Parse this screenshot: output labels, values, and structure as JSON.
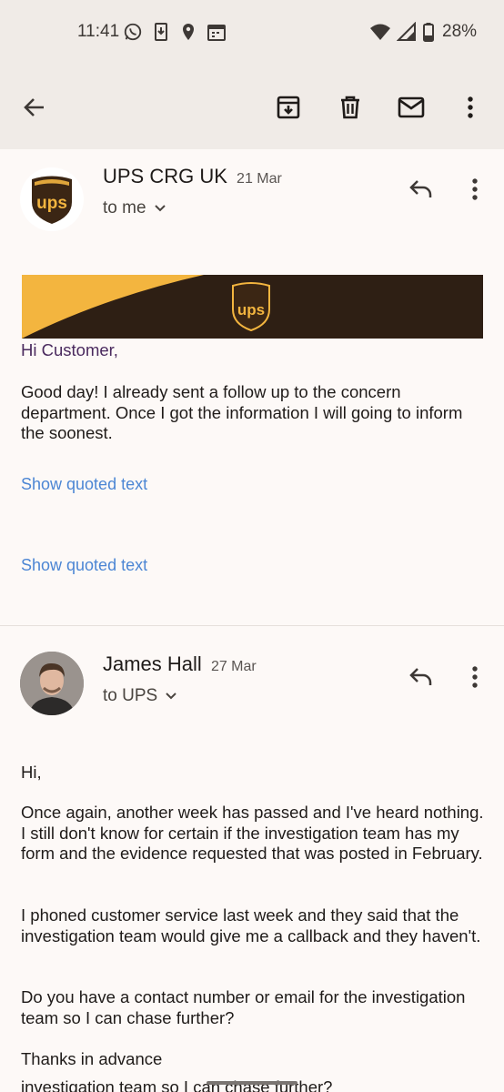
{
  "status": {
    "time": "11:41",
    "battery": "28%"
  },
  "toolbar": {
    "back": "back",
    "archive": "archive",
    "delete": "delete",
    "mark_unread": "mark unread",
    "more": "more"
  },
  "messages": [
    {
      "sender": "UPS CRG UK",
      "date": "21 Mar",
      "recipient": "to me",
      "greeting": "Hi Customer,",
      "body": "Good day! I already sent a follow up to the concern department. Once I got the information I will going to inform the soonest.",
      "quoted_1": "Show quoted text",
      "quoted_2": "Show quoted text",
      "logo_text": "ups"
    },
    {
      "sender": "James Hall",
      "date": "27 Mar",
      "recipient": "to UPS",
      "paragraphs": [
        "Hi,",
        "Once again, another week has passed and I've heard nothing. I still don't know for certain if the investigation team has my form and the evidence requested that was posted in February.",
        "I phoned customer service last week and they said that the investigation team would give me a callback and they haven't.",
        "Do you have a contact number or email for the investigation team so I can chase further?",
        "Thanks in advance"
      ],
      "peek": "investigation team so I can chase further?"
    }
  ],
  "icons": [
    "whatsapp-icon",
    "download-icon",
    "location-icon",
    "calendar-icon",
    "wifi-icon",
    "signal-icon",
    "battery-icon",
    "back-arrow-icon",
    "archive-icon",
    "trash-icon",
    "mail-icon",
    "more-vert-icon",
    "reply-icon",
    "chevron-down-icon"
  ],
  "colors": {
    "ups_brown": "#3b2614",
    "ups_gold": "#f3b53f",
    "link": "#4c86d4"
  }
}
